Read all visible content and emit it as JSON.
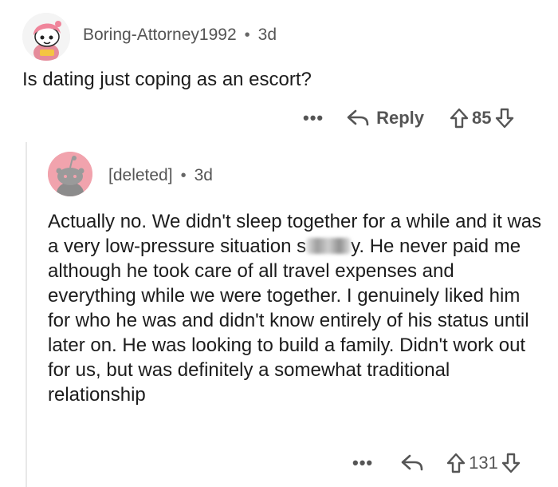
{
  "op": {
    "username": "Boring-Attorney1992",
    "separator": "•",
    "age": "3d",
    "text": "Is dating just coping as an escort?",
    "actions": {
      "more_label": "•••",
      "reply_label": "Reply",
      "score": "85"
    }
  },
  "reply": {
    "username": "[deleted]",
    "separator": "•",
    "age": "3d",
    "text_before_redaction": "Actually no. We didn't sleep together for a while and it was a very low-pressure situation s",
    "text_after_redaction": "y. He never paid me although he took care of all travel expenses and everything while we were together. I genuinely liked him for who he was and didn't know entirely of his status until later on. He was looking to build a family. Didn't work out for us, but was definitely a somewhat traditional relationship",
    "actions": {
      "more_label": "•••",
      "score": "131"
    }
  },
  "icons": {
    "reply": "reply-arrow-icon",
    "upvote": "upvote-arrow-icon",
    "downvote": "downvote-arrow-icon",
    "more": "more-dots-icon"
  },
  "colors": {
    "text": "#1c1c1c",
    "meta": "#555555",
    "deleted_avatar": "#f1a3ad"
  }
}
